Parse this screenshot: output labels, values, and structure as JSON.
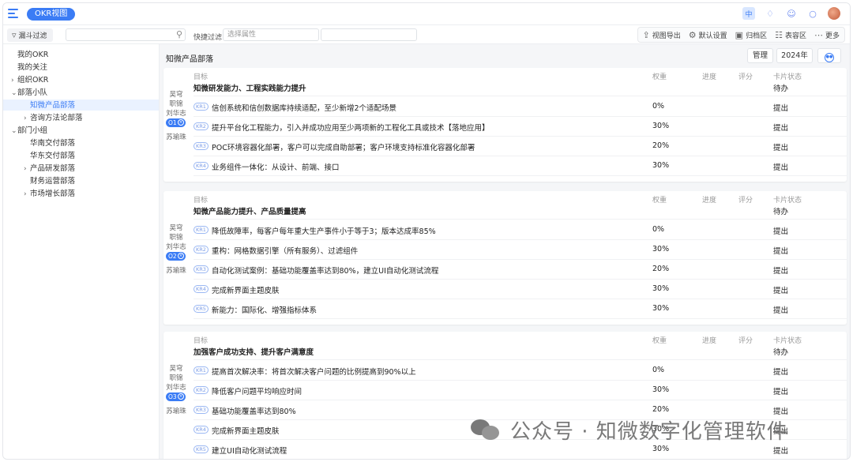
{
  "topbar": {
    "view_pill": "OKR视图",
    "icons": [
      "menu-icon",
      "language-icon",
      "bell-icon",
      "user-icon",
      "chat-icon"
    ],
    "lang_label": "中"
  },
  "filterbar": {
    "funnel_label": "漏斗过滤",
    "search_placeholder": "",
    "quick_filter_label": "快捷过滤",
    "attribute_placeholder": "选择属性",
    "tools": [
      {
        "label": "视图导出",
        "icon": "export-icon"
      },
      {
        "label": "默认设置",
        "icon": "gear-icon"
      },
      {
        "label": "归档区",
        "icon": "archive-icon"
      },
      {
        "label": "表容区",
        "icon": "table-icon"
      },
      {
        "label": "更多",
        "icon": "more-icon"
      }
    ]
  },
  "sidebar": {
    "items": [
      {
        "label": "我的OKR",
        "level": 0,
        "chevron": ""
      },
      {
        "label": "我的关注",
        "level": 0,
        "chevron": ""
      },
      {
        "label": "组织OKR",
        "level": 0,
        "chevron": ">"
      },
      {
        "label": "部落小队",
        "level": 0,
        "chevron": "v"
      },
      {
        "label": "知微产品部落",
        "level": 2,
        "chevron": "",
        "selected": true
      },
      {
        "label": "咨询方法论部落",
        "level": 1,
        "chevron": ">"
      },
      {
        "label": "部门小组",
        "level": 0,
        "chevron": "v"
      },
      {
        "label": "华南交付部落",
        "level": 1,
        "chevron": ""
      },
      {
        "label": "华东交付部落",
        "level": 1,
        "chevron": ""
      },
      {
        "label": "产品研发部落",
        "level": 1,
        "chevron": ">"
      },
      {
        "label": "财务运营部落",
        "level": 1,
        "chevron": ""
      },
      {
        "label": "市场增长部落",
        "level": 1,
        "chevron": ">"
      }
    ]
  },
  "main": {
    "dept_title": "知微产品部落",
    "manage_label": "管理",
    "year_label": "2024年",
    "columns": {
      "objective": "目标",
      "weight": "权重",
      "progress": "进度",
      "score": "评分",
      "card_status": "卡片状态"
    },
    "objectives": [
      {
        "badge": "O1",
        "owners": [
          "吴穹",
          "职锦",
          "刘华志"
        ],
        "owner_bottom": "苏瑜珠",
        "title": "知微研发能力、工程实践能力提升",
        "status": "待办",
        "krs": [
          {
            "badge": "KR1",
            "text": "信创系统和信创数据库持续适配，至少新增2个适配场景",
            "weight": "0%",
            "status": "提出"
          },
          {
            "badge": "KR2",
            "text": "提升平台化工程能力，引入并成功应用至少两项新的工程化工具或技术【落地应用】",
            "weight": "30%",
            "status": "提出"
          },
          {
            "badge": "KR3",
            "text": "POC环境容器化部署，客户可以完成自助部署；客户环境支持标准化容器化部署",
            "weight": "20%",
            "status": "提出"
          },
          {
            "badge": "KR4",
            "text": "业务组件一体化：从设计、前端、接口",
            "weight": "30%",
            "status": "提出"
          }
        ]
      },
      {
        "badge": "O2",
        "owners": [
          "吴穹",
          "职锦",
          "刘华志"
        ],
        "owner_bottom": "苏瑜珠",
        "title": "知微产品能力提升、产品质量提高",
        "status": "待办",
        "krs": [
          {
            "badge": "KR1",
            "text": "降低故障率，每客户每年重大生产事件小于等于3；版本达成率85%",
            "weight": "0%",
            "status": "提出"
          },
          {
            "badge": "KR2",
            "text": "重构：网格数据引擎（所有服务）、过滤组件",
            "weight": "30%",
            "status": "提出"
          },
          {
            "badge": "KR3",
            "text": "自动化测试案例：基础功能覆盖率达到80%，建立UI自动化测试流程",
            "weight": "20%",
            "status": "提出"
          },
          {
            "badge": "KR4",
            "text": "完成新界面主题皮肤",
            "weight": "30%",
            "status": "提出"
          },
          {
            "badge": "KR5",
            "text": "新能力：国际化、增强指标体系",
            "weight": "30%",
            "status": "提出"
          }
        ]
      },
      {
        "badge": "O3",
        "owners": [
          "吴穹",
          "职锦",
          "刘华志"
        ],
        "owner_bottom": "苏瑜珠",
        "title": "加强客户成功支持、提升客户满意度",
        "status": "待办",
        "krs": [
          {
            "badge": "KR1",
            "text": "提高首次解决率：将首次解决客户问题的比例提高到90%以上",
            "weight": "0%",
            "status": "提出"
          },
          {
            "badge": "KR2",
            "text": "降低客户问题平均响应时间",
            "weight": "30%",
            "status": "提出"
          },
          {
            "badge": "KR3",
            "text": "基础功能覆盖率达到80%",
            "weight": "20%",
            "status": "提出"
          },
          {
            "badge": "KR4",
            "text": "完成新界面主题皮肤",
            "weight": "30%",
            "status": "提出"
          },
          {
            "badge": "KR5",
            "text": "建立UI自动化测试流程",
            "weight": "30%",
            "status": "提出"
          }
        ]
      }
    ]
  },
  "watermark": {
    "text": "公众号 · 知微数字化管理软件"
  },
  "colors": {
    "accent": "#3b7cf5",
    "selected_bg": "#eaf2ff",
    "panel_bg": "#f5f6f8"
  }
}
